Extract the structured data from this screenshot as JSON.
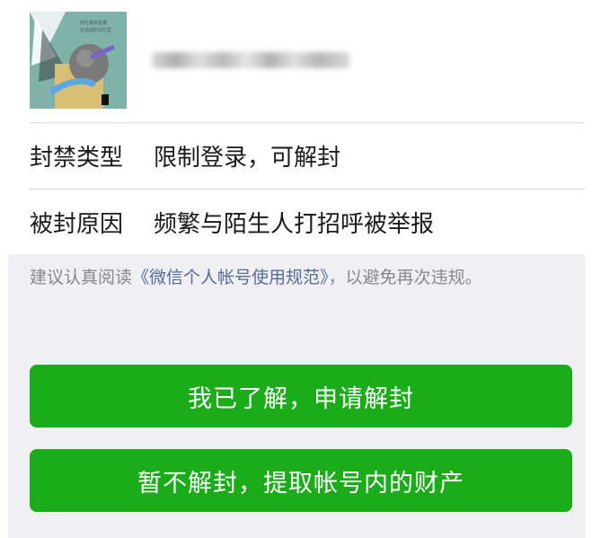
{
  "profile": {
    "avatar_icon": "profile-avatar-image",
    "avatar_caption_line1": "你在我的星野",
    "avatar_caption_line2": "在遥远的记忆里"
  },
  "info": {
    "ban_type_label": "封禁类型",
    "ban_type_value": "限制登录，可解封",
    "ban_reason_label": "被封原因",
    "ban_reason_value": "频繁与陌生人打招呼被举报"
  },
  "notice": {
    "prefix": "建议认真阅读",
    "link": "《微信个人帐号使用规范》",
    "suffix": "，以避免再次违规。"
  },
  "buttons": {
    "unblock_label": "我已了解，申请解封",
    "withdraw_label": "暂不解封，提取帐号内的财产"
  },
  "colors": {
    "primary_green": "#1aad19",
    "link_blue": "#576b95",
    "background_gray": "#efeff4",
    "notice_gray": "#888888"
  }
}
